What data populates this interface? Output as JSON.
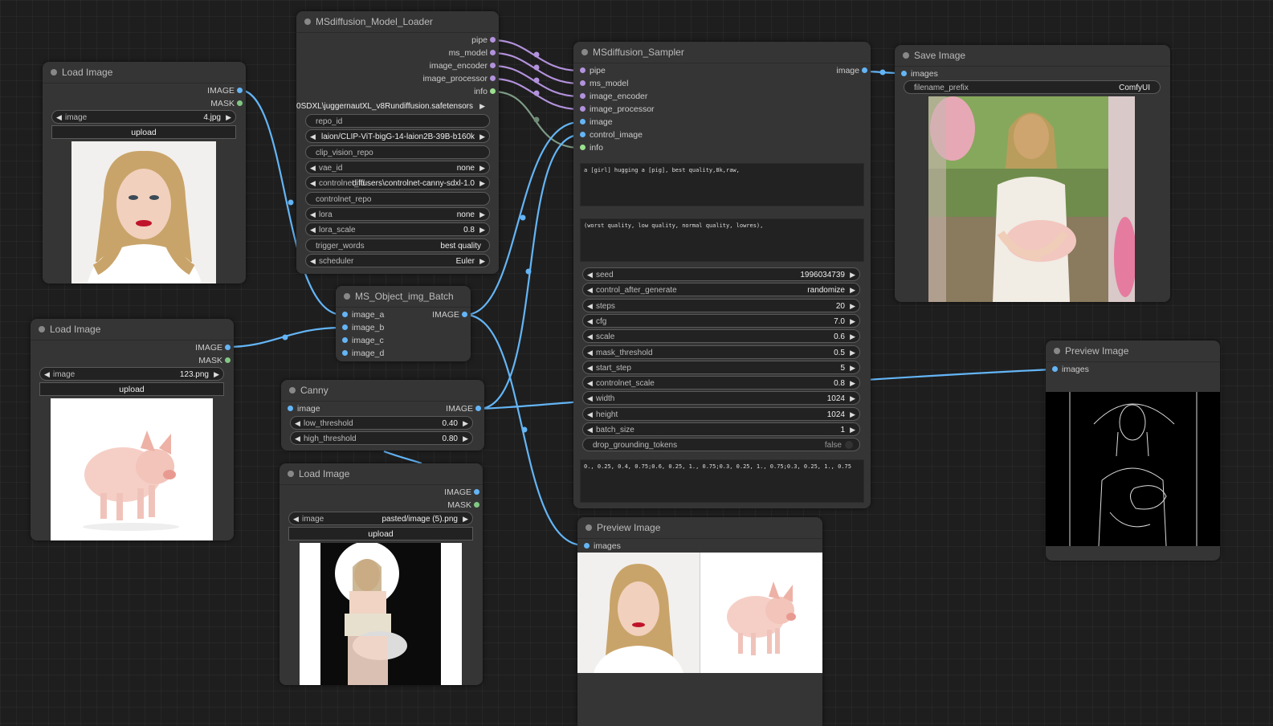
{
  "colors": {
    "pipe": "#b392dd",
    "image": "#64b5f6",
    "mask": "#81c784",
    "info": "#9be08f"
  },
  "nodes": {
    "load1": {
      "title": "Load Image",
      "out1": "IMAGE",
      "out2": "MASK",
      "w_image_k": "image",
      "w_image_v": "4.jpg",
      "upload": "upload",
      "img_icon": "portrait-woman-image"
    },
    "load2": {
      "title": "Load Image",
      "out1": "IMAGE",
      "out2": "MASK",
      "w_image_k": "image",
      "w_image_v": "123.png",
      "upload": "upload",
      "img_icon": "piglet-image"
    },
    "load3": {
      "title": "Load Image",
      "out1": "IMAGE",
      "out2": "MASK",
      "w_image_k": "image",
      "w_image_v": "pasted/image (5).png",
      "upload": "upload",
      "img_icon": "girl-holding-pig-image"
    },
    "loader": {
      "title": "MSdiffusion_Model_Loader",
      "outputs": [
        "pipe",
        "ms_model",
        "image_encoder",
        "image_processor",
        "info"
      ],
      "ckpt_v": "0SDXL\\juggernautXL_v8Rundiffusion.safetensors",
      "repo_id": "repo_id",
      "clip_v": "laion/CLIP-ViT-bigG-14-laion2B-39B-b160k",
      "clip_vision_repo": "clip_vision_repo",
      "vae_k": "vae_id",
      "vae_v": "none",
      "controlnet_k": "controlnet_id",
      "controlnet_v": "diffusers\\controlnet-canny-sdxl-1.0",
      "controlnet_repo": "controlnet_repo",
      "lora_k": "lora",
      "lora_v": "none",
      "lora_scale_k": "lora_scale",
      "lora_scale_v": "0.8",
      "trigger_k": "trigger_words",
      "trigger_v": "best quality",
      "scheduler_k": "scheduler",
      "scheduler_v": "Euler"
    },
    "batch": {
      "title": "MS_Object_img_Batch",
      "inputs": [
        "image_a",
        "image_b",
        "image_c",
        "image_d"
      ],
      "out": "IMAGE"
    },
    "canny": {
      "title": "Canny",
      "in": "image",
      "out": "IMAGE",
      "low_k": "low_threshold",
      "low_v": "0.40",
      "high_k": "high_threshold",
      "high_v": "0.80"
    },
    "sampler": {
      "title": "MSdiffusion_Sampler",
      "inputs": [
        "pipe",
        "ms_model",
        "image_encoder",
        "image_processor",
        "image",
        "control_image",
        "info"
      ],
      "out": "image",
      "prompt": "a [girl] hugging a [pig], best quality,8k,raw,",
      "negative": "(worst quality, low quality, normal quality, lowres),",
      "widgets": [
        {
          "k": "seed",
          "v": "1996034739"
        },
        {
          "k": "control_after_generate",
          "v": "randomize"
        },
        {
          "k": "steps",
          "v": "20"
        },
        {
          "k": "cfg",
          "v": "7.0"
        },
        {
          "k": "scale",
          "v": "0.6"
        },
        {
          "k": "mask_threshold",
          "v": "0.5"
        },
        {
          "k": "start_step",
          "v": "5"
        },
        {
          "k": "controlnet_scale",
          "v": "0.8"
        },
        {
          "k": "width",
          "v": "1024"
        },
        {
          "k": "height",
          "v": "1024"
        },
        {
          "k": "batch_size",
          "v": "1"
        }
      ],
      "drop_k": "drop_grounding_tokens",
      "drop_v": "false",
      "boxes": "0., 0.25, 0.4, 0.75;0.6, 0.25, 1., 0.75;0.3, 0.25, 1., 0.75;0.3, 0.25, 1., 0.75"
    },
    "save": {
      "title": "Save Image",
      "in": "images",
      "prefix_k": "filename_prefix",
      "prefix_v": "ComfyUI",
      "img_icon": "generated-girl-hugging-pig-image"
    },
    "preview1": {
      "title": "Preview Image",
      "in": "images",
      "img_icon": "canny-edge-map-image"
    },
    "preview2": {
      "title": "Preview Image",
      "in": "images",
      "img_icon": "batch-preview-images"
    }
  }
}
